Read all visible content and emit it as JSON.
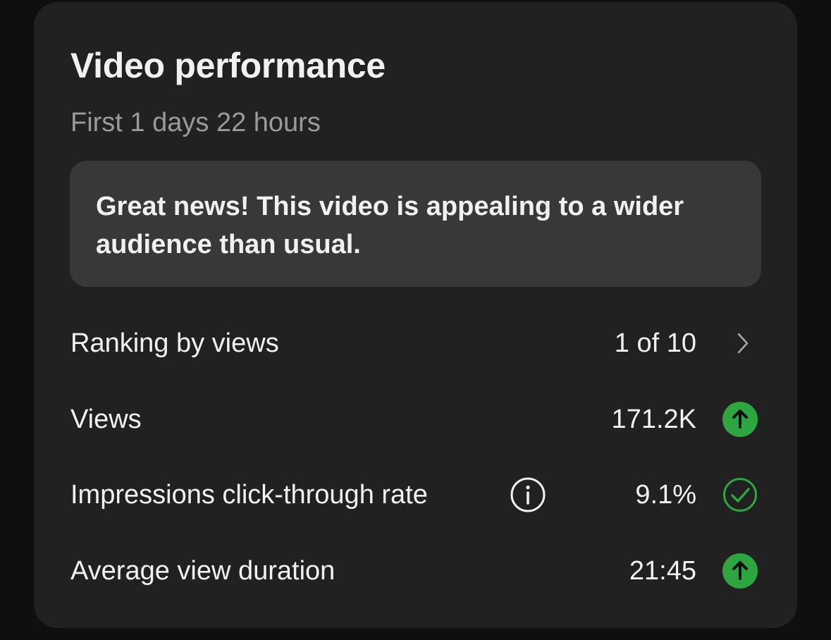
{
  "card": {
    "title": "Video performance",
    "subtitle": "First 1 days 22 hours",
    "banner": "Great news! This video is appealing to a wider audience than usual."
  },
  "metrics": [
    {
      "label": "Ranking by views",
      "value": "1 of 10",
      "icon": "chevron-right-icon"
    },
    {
      "label": "Views",
      "value": "171.2K",
      "icon": "arrow-up-circle-icon"
    },
    {
      "label": "Impressions click-through rate",
      "value": "9.1%",
      "icon": "check-circle-icon",
      "has_info": true
    },
    {
      "label": "Average view duration",
      "value": "21:45",
      "icon": "arrow-up-circle-icon"
    }
  ],
  "colors": {
    "accent_green": "#2ba640",
    "card_bg": "#212121",
    "banner_bg": "#383838",
    "text_primary": "#f1f1f1",
    "text_secondary": "#9a9a9a"
  }
}
